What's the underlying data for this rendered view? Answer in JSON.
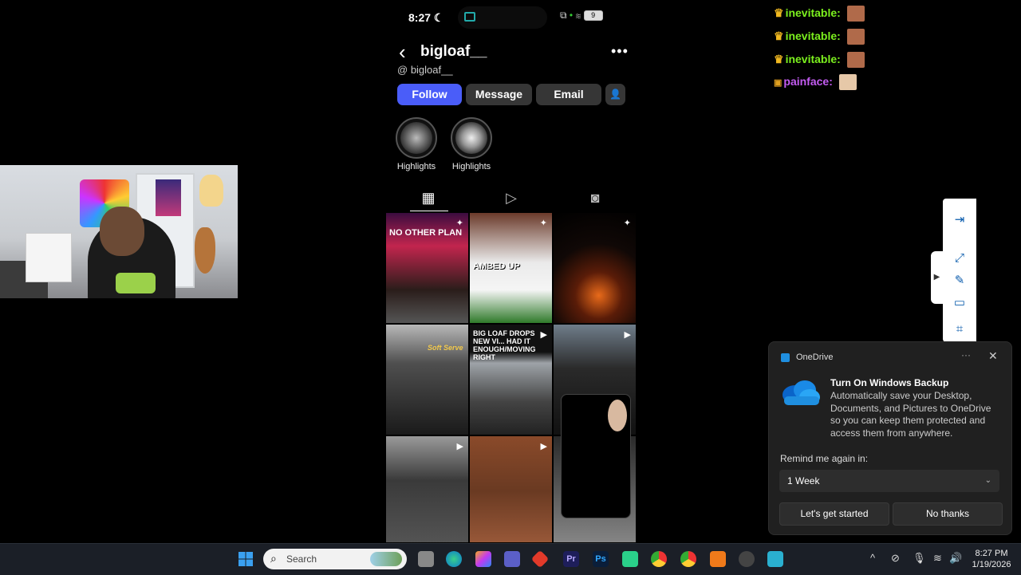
{
  "phone": {
    "status": {
      "time": "8:27",
      "moon": "☾",
      "battery": "9"
    },
    "profile": {
      "username": "bigloaf__",
      "handle": "bigloaf__"
    },
    "buttons": {
      "follow": "Follow",
      "message": "Message",
      "email": "Email"
    },
    "highlights": [
      {
        "label": "Highlights"
      },
      {
        "label": "Highlights"
      }
    ],
    "grid_text": {
      "post1": "NO OTHER PLAN",
      "post2": "AMBED UP",
      "post4": "Soft Serve",
      "post5": "BIG LOAF DROPS NEW VI... HAD IT ENOUGH/MOVING RIGHT"
    }
  },
  "chat": [
    {
      "user": "inevitable:",
      "color": "#7cf01e",
      "badge": "crown-icon"
    },
    {
      "user": "inevitable:",
      "color": "#7cf01e",
      "badge": "crown-icon"
    },
    {
      "user": "inevitable:",
      "color": "#7cf01e",
      "badge": "crown-icon"
    },
    {
      "user": "painface:",
      "color": "#c45cf2",
      "badge": "sub-badge-icon"
    }
  ],
  "onedrive": {
    "app": "OneDrive",
    "title": "Turn On Windows Backup",
    "body": "Automatically save your Desktop, Documents, and Pictures to OneDrive so you can keep them protected and access them from anywhere.",
    "remind_label": "Remind me again in:",
    "remind_value": "1 Week",
    "primary": "Let's get started",
    "secondary": "No thanks"
  },
  "taskbar": {
    "search_placeholder": "Search",
    "time": "8:27 PM",
    "date": "1/19/2026"
  },
  "colors": {
    "accent": "#4a5df9",
    "onedrive_bg": "#202020",
    "taskbar_bg": "#1b1f27"
  }
}
